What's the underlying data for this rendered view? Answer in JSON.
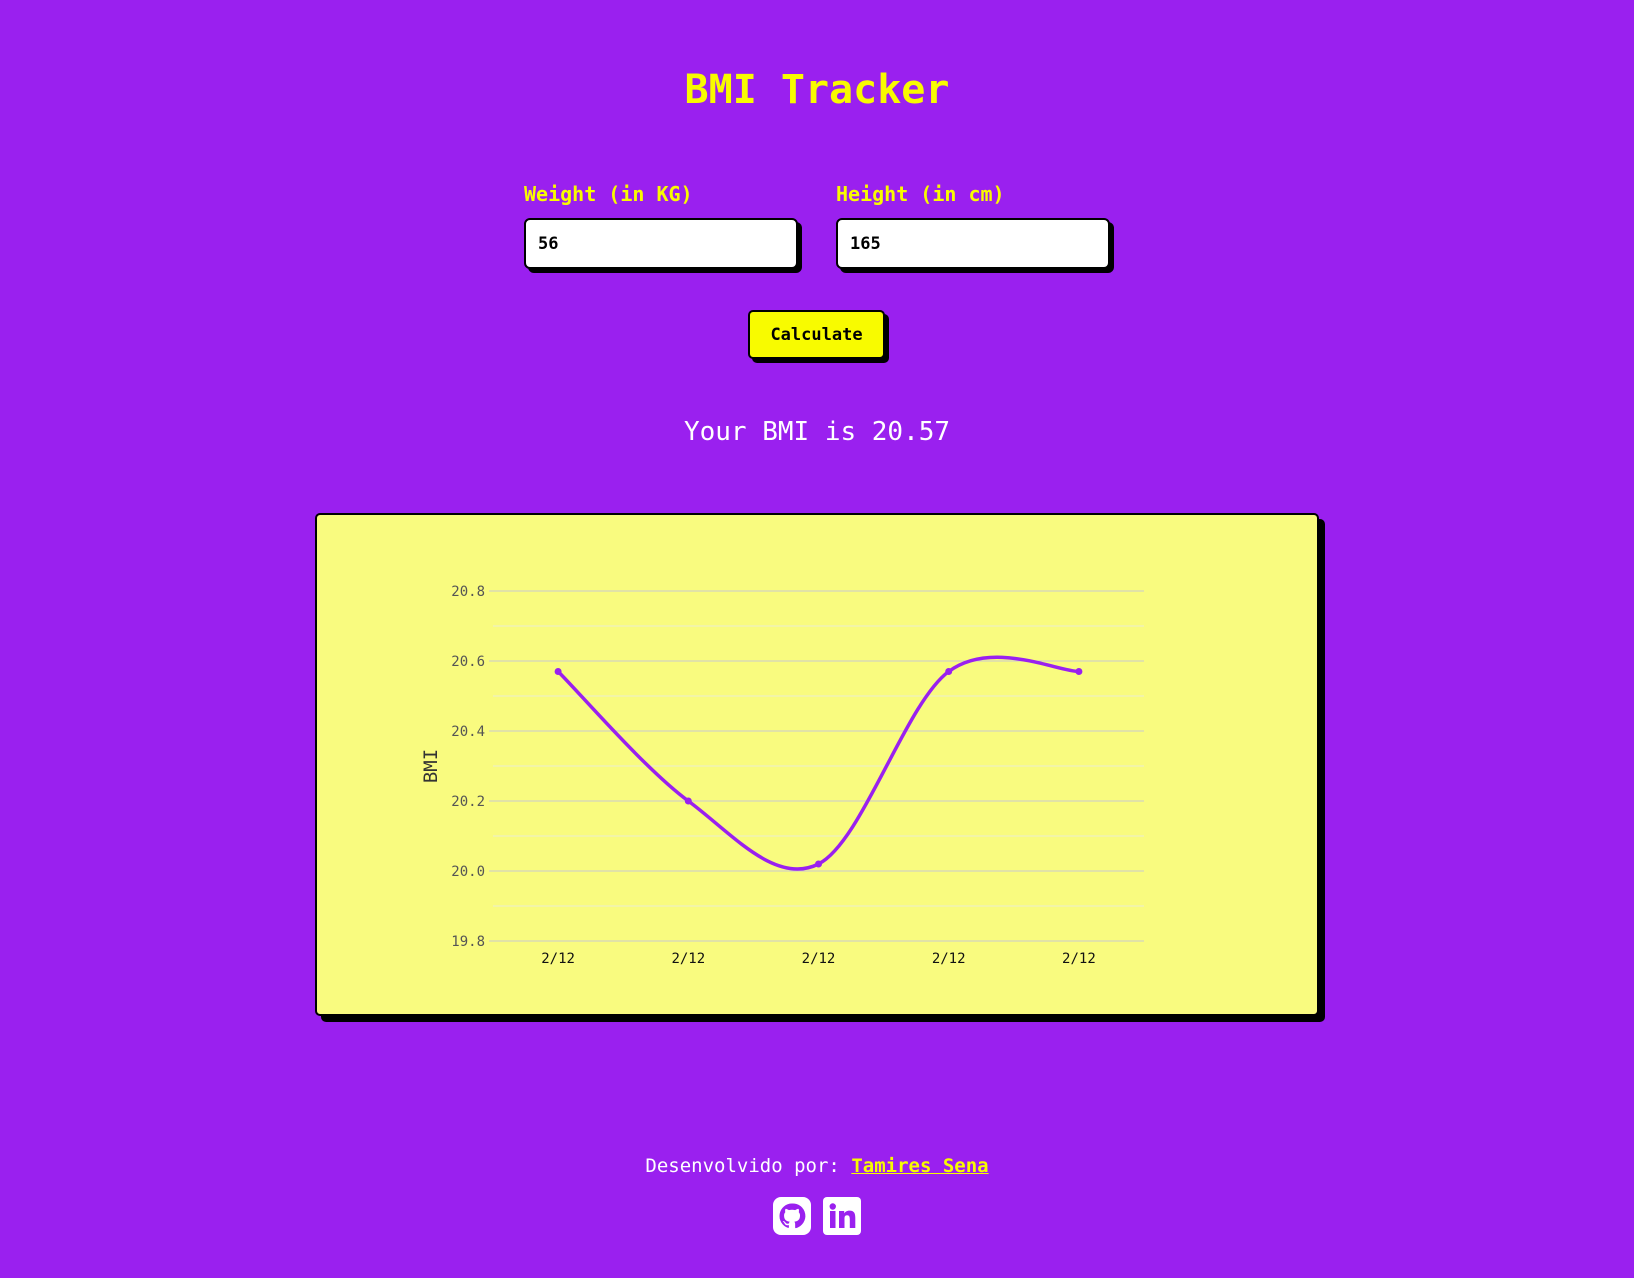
{
  "header": {
    "title": "BMI Tracker"
  },
  "form": {
    "weight": {
      "label": "Weight (in KG)",
      "value": "56"
    },
    "height": {
      "label": "Height (in cm)",
      "value": "165"
    },
    "calculate_label": "Calculate"
  },
  "result": {
    "text": "Your BMI is 20.57"
  },
  "chart_data": {
    "type": "line",
    "categories": [
      "2/12",
      "2/12",
      "2/12",
      "2/12",
      "2/12"
    ],
    "values": [
      20.57,
      20.2,
      20.02,
      20.57,
      20.57
    ],
    "title": "",
    "xlabel": "",
    "ylabel": "BMI",
    "ylim": [
      19.8,
      20.8
    ],
    "yticks": [
      "20.8",
      "20.6",
      "20.4",
      "20.2",
      "20.0",
      "19.8"
    ],
    "grid": true,
    "smooth": true,
    "line_color": "#9a20ef",
    "background": "#f9fb7f"
  },
  "footer": {
    "credit_prefix": "Desenvolvido por:",
    "author_name": "Tamires Sena",
    "social_icons": [
      "github-icon",
      "linkedin-icon"
    ]
  },
  "colors": {
    "background": "#9a20ef",
    "accent": "#f8fb00",
    "card": "#f9fb7f"
  }
}
